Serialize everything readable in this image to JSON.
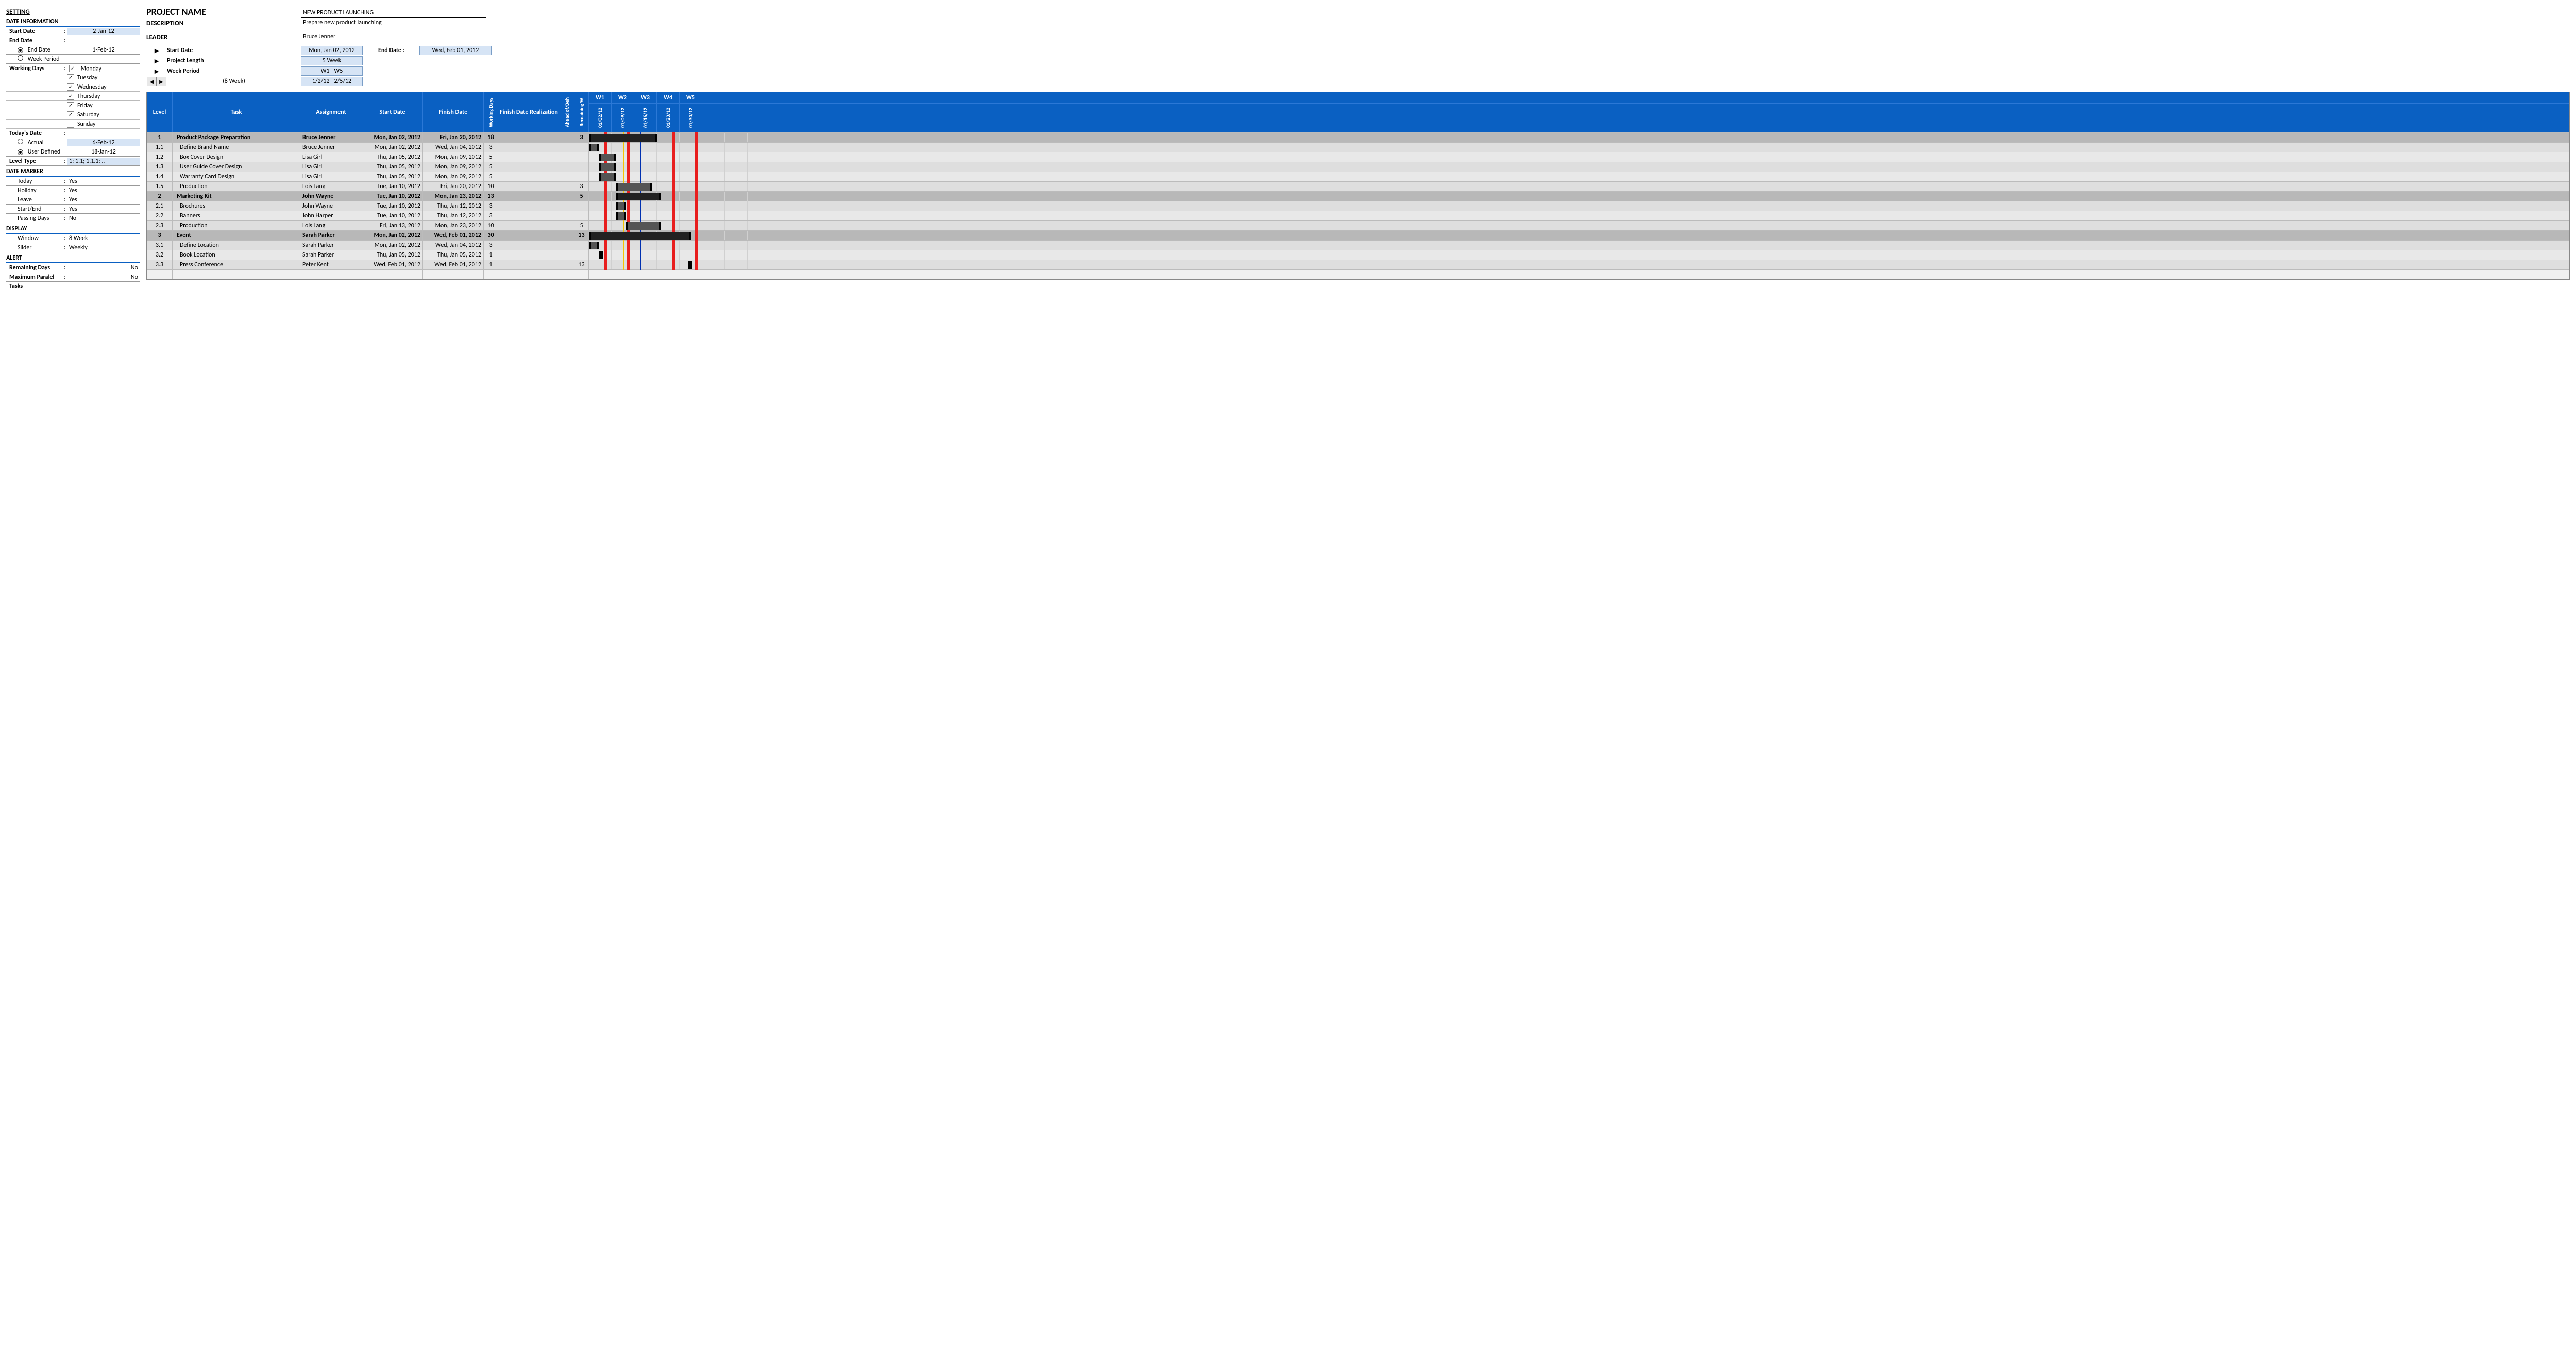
{
  "setting": {
    "title": "SETTING",
    "date_info": {
      "title": "DATE INFORMATION",
      "start_date_label": "Start Date",
      "start_date": "2-Jan-12",
      "end_date_label_top": "End Date",
      "end_date_radio": "End Date",
      "end_date_value": "1-Feb-12",
      "week_period_radio": "Week Period",
      "working_days_label": "Working Days",
      "days": [
        {
          "label": "Monday",
          "checked": true
        },
        {
          "label": "Tuesday",
          "checked": true
        },
        {
          "label": "Wednesday",
          "checked": true
        },
        {
          "label": "Thursday",
          "checked": true
        },
        {
          "label": "Friday",
          "checked": true
        },
        {
          "label": "Saturday",
          "checked": true
        },
        {
          "label": "Sunday",
          "checked": false
        }
      ],
      "todays_date_label": "Today's Date",
      "actual_label": "Actual",
      "actual_value": "6-Feb-12",
      "user_defined_label": "User Defined",
      "user_defined_value": "18-Jan-12",
      "level_type_label": "Level Type",
      "level_type_value": "1; 1.1; 1.1.1; .."
    },
    "date_marker": {
      "title": "DATE MARKER",
      "today_label": "Today",
      "today": "Yes",
      "holiday_label": "Holiday",
      "holiday": "Yes",
      "leave_label": "Leave",
      "leave": "Yes",
      "startend_label": "Start/End",
      "startend": "Yes",
      "passing_label": "Passing Days",
      "passing": "No"
    },
    "display": {
      "title": "DISPLAY",
      "window_label": "Window",
      "window": "8 Week",
      "slider_label": "Slider",
      "slider": "Weekly"
    },
    "alert": {
      "title": "ALERT",
      "remaining_label": "Remaining Days",
      "remaining": "No",
      "max_label": "Maximum Paralel",
      "max": "No",
      "tasks_label": "Tasks"
    }
  },
  "project": {
    "name_label": "PROJECT NAME",
    "name": "NEW PRODUCT LAUNCHING",
    "desc_label": "DESCRIPTION",
    "desc": "Prepare new product launching",
    "leader_label": "LEADER",
    "leader": "Bruce Jenner",
    "summary": {
      "start_label": "Start Date",
      "start": "Mon, Jan 02, 2012",
      "end_label": "End Date :",
      "end": "Wed, Feb 01, 2012",
      "length_label": "Project Length",
      "length": "5 Week",
      "period_label": "Week Period",
      "period": "W1 - W5",
      "slider_caption": "(8 Week)",
      "slider_range": "1/2/12 - 2/5/12"
    }
  },
  "grid": {
    "headers": {
      "level": "Level",
      "task": "Task",
      "assign": "Assignment",
      "start": "Start Date",
      "finish": "Finish Date",
      "wd": "Working Days",
      "fdr": "Finish Date Realization",
      "ab": "Ahead of/Beh",
      "rw": "Remaining W"
    },
    "weeks": [
      "W1",
      "W2",
      "W3",
      "W4",
      "W5"
    ],
    "week_dates": [
      "01/02/12",
      "01/09/12",
      "01/16/12",
      "01/23/12",
      "01/30/12"
    ],
    "rows": [
      {
        "level": "1",
        "task": "Product Package Preparation",
        "assign": "Bruce Jenner",
        "sd": "Mon, Jan 02, 2012",
        "fd": "Fri, Jan 20, 2012",
        "wd": "18",
        "rw": "3",
        "parent": true,
        "bar_start": 0,
        "bar_end": 132
      },
      {
        "level": "1.1",
        "task": "Define Brand Name",
        "assign": "Bruce Jenner",
        "sd": "Mon, Jan 02, 2012",
        "fd": "Wed, Jan 04, 2012",
        "wd": "3",
        "rw": "",
        "bar_start": 0,
        "bar_end": 20
      },
      {
        "level": "1.2",
        "task": "Box Cover Design",
        "assign": "Lisa Girl",
        "sd": "Thu, Jan 05, 2012",
        "fd": "Mon, Jan 09, 2012",
        "wd": "5",
        "rw": "",
        "bar_start": 20,
        "bar_end": 52
      },
      {
        "level": "1.3",
        "task": "User Guide Cover Design",
        "assign": "Lisa Girl",
        "sd": "Thu, Jan 05, 2012",
        "fd": "Mon, Jan 09, 2012",
        "wd": "5",
        "rw": "",
        "bar_start": 20,
        "bar_end": 52
      },
      {
        "level": "1.4",
        "task": "Warranty Card Design",
        "assign": "Lisa Girl",
        "sd": "Thu, Jan 05, 2012",
        "fd": "Mon, Jan 09, 2012",
        "wd": "5",
        "rw": "",
        "bar_start": 20,
        "bar_end": 52
      },
      {
        "level": "1.5",
        "task": "Production",
        "assign": "Lois Lang",
        "sd": "Tue, Jan 10, 2012",
        "fd": "Fri, Jan 20, 2012",
        "wd": "10",
        "rw": "3",
        "bar_start": 52,
        "bar_end": 122
      },
      {
        "level": "2",
        "task": "Marketing Kit",
        "assign": "John Wayne",
        "sd": "Tue, Jan 10, 2012",
        "fd": "Mon, Jan 23, 2012",
        "wd": "13",
        "rw": "5",
        "parent": true,
        "bar_start": 52,
        "bar_end": 140
      },
      {
        "level": "2.1",
        "task": "Brochures",
        "assign": "John Wayne",
        "sd": "Tue, Jan 10, 2012",
        "fd": "Thu, Jan 12, 2012",
        "wd": "3",
        "rw": "",
        "bar_start": 52,
        "bar_end": 72
      },
      {
        "level": "2.2",
        "task": "Banners",
        "assign": "John Harper",
        "sd": "Tue, Jan 10, 2012",
        "fd": "Thu, Jan 12, 2012",
        "wd": "3",
        "rw": "",
        "bar_start": 52,
        "bar_end": 72
      },
      {
        "level": "2.3",
        "task": "Production",
        "assign": "Lois Lang",
        "sd": "Fri, Jan 13, 2012",
        "fd": "Mon, Jan 23, 2012",
        "wd": "10",
        "rw": "5",
        "bar_start": 72,
        "bar_end": 140
      },
      {
        "level": "3",
        "task": "Event",
        "assign": "Sarah Parker",
        "sd": "Mon, Jan 02, 2012",
        "fd": "Wed, Feb 01, 2012",
        "wd": "30",
        "rw": "13",
        "parent": true,
        "bar_start": 0,
        "bar_end": 198
      },
      {
        "level": "3.1",
        "task": "Define Location",
        "assign": "Sarah Parker",
        "sd": "Mon, Jan 02, 2012",
        "fd": "Wed, Jan 04, 2012",
        "wd": "3",
        "rw": "",
        "bar_start": 0,
        "bar_end": 20
      },
      {
        "level": "3.2",
        "task": "Book Location",
        "assign": "Sarah Parker",
        "sd": "Thu, Jan 05, 2012",
        "fd": "Thu, Jan 05, 2012",
        "wd": "1",
        "rw": "",
        "bar_start": 20,
        "bar_end": 28
      },
      {
        "level": "3.3",
        "task": "Press Conference",
        "assign": "Peter Kent",
        "sd": "Wed, Feb 01, 2012",
        "fd": "Wed, Feb 01, 2012",
        "wd": "1",
        "rw": "13",
        "bar_start": 192,
        "bar_end": 200
      }
    ],
    "markers": {
      "red_positions": [
        30,
        74,
        162,
        206
      ],
      "yellow": 66,
      "blue": 100
    }
  }
}
